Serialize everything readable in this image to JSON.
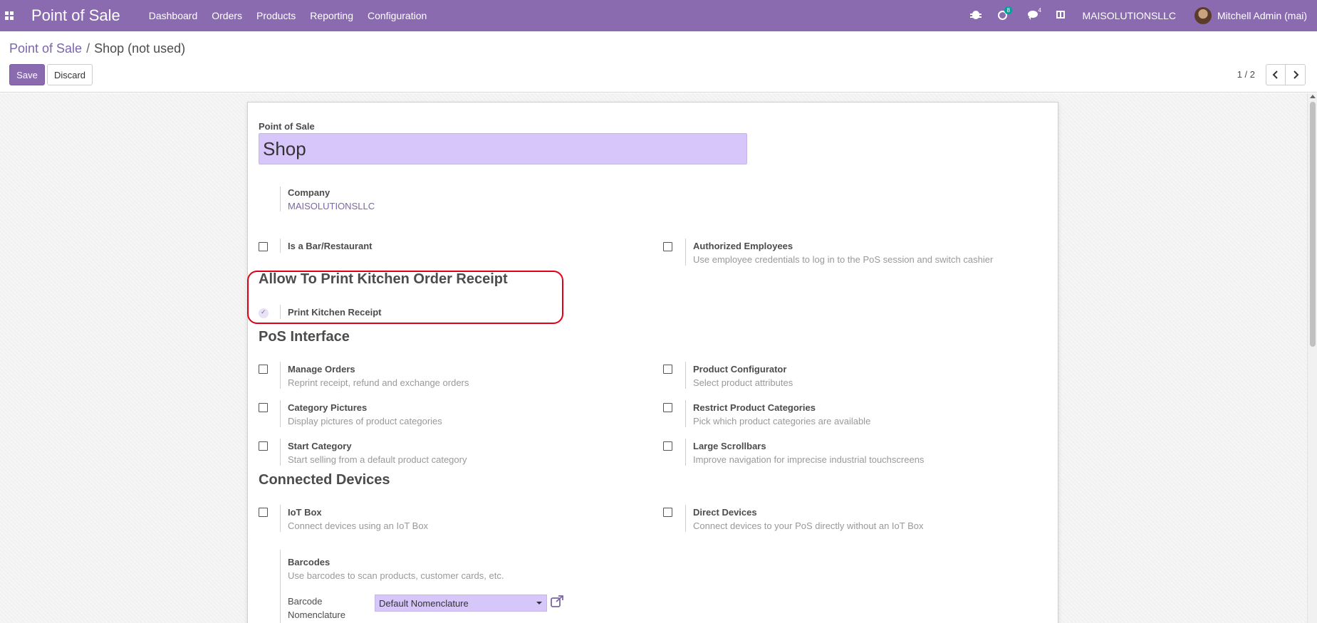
{
  "navbar": {
    "app_title": "Point of Sale",
    "menu": [
      "Dashboard",
      "Orders",
      "Products",
      "Reporting",
      "Configuration"
    ],
    "activity_count": "8",
    "messages_count": "4",
    "company": "MAISOLUTIONSLLC",
    "user": "Mitchell Admin (mai)",
    "brand_color": "#8a6baf"
  },
  "breadcrumb": {
    "parent": "Point of Sale",
    "separator": "/",
    "current": "Shop (not used)"
  },
  "actions": {
    "save": "Save",
    "discard": "Discard"
  },
  "pager": {
    "value": "1 / 2"
  },
  "form": {
    "name_label": "Point of Sale",
    "name_value": "Shop",
    "company_label": "Company",
    "company_value": "MAISOLUTIONSLLC",
    "is_bar": {
      "label": "Is a Bar/Restaurant",
      "checked": false
    },
    "authorized_employees": {
      "label": "Authorized Employees",
      "desc": "Use employee credentials to log in to the PoS session and switch cashier",
      "checked": false
    },
    "kitchen_section": "Allow To Print Kitchen Order Receipt",
    "print_kitchen": {
      "label": "Print Kitchen Receipt",
      "checked": true
    },
    "pos_interface_section": "PoS Interface",
    "manage_orders": {
      "label": "Manage Orders",
      "desc": "Reprint receipt, refund and exchange orders"
    },
    "product_configurator": {
      "label": "Product Configurator",
      "desc": "Select product attributes"
    },
    "category_pictures": {
      "label": "Category Pictures",
      "desc": "Display pictures of product categories"
    },
    "restrict_categories": {
      "label": "Restrict Product Categories",
      "desc": "Pick which product categories are available"
    },
    "start_category": {
      "label": "Start Category",
      "desc": "Start selling from a default product category"
    },
    "large_scrollbars": {
      "label": "Large Scrollbars",
      "desc": "Improve navigation for imprecise industrial touchscreens"
    },
    "connected_devices_section": "Connected Devices",
    "iot_box": {
      "label": "IoT Box",
      "desc": "Connect devices using an IoT Box"
    },
    "direct_devices": {
      "label": "Direct Devices",
      "desc": "Connect devices to your PoS directly without an IoT Box"
    },
    "barcodes": {
      "label": "Barcodes",
      "desc": "Use barcodes to scan products, customer cards, etc."
    },
    "barcode_nomenclature": {
      "label_line1": "Barcode",
      "label_line2": "Nomenclature",
      "value": "Default Nomenclature"
    }
  }
}
